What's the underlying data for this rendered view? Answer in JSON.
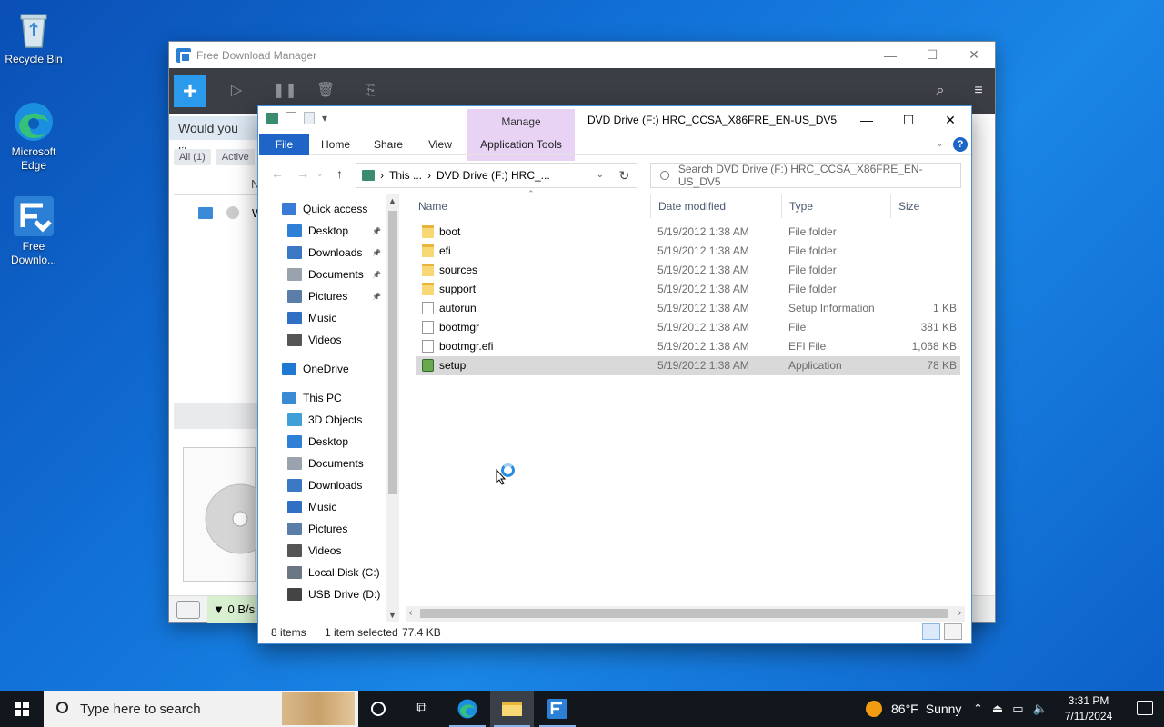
{
  "desktop": {
    "icons": [
      {
        "label": "Recycle Bin"
      },
      {
        "label": "Microsoft Edge"
      },
      {
        "label": "Free Downlo..."
      }
    ]
  },
  "fdm": {
    "title": "Free Download Manager",
    "prompt": "Would you like",
    "filters": [
      "All (1)",
      "Active"
    ],
    "list_header_initial": "N",
    "row_initial": "W",
    "speed": "▼ 0 B/s"
  },
  "explorer": {
    "manage_label": "Manage",
    "caption": "DVD Drive (F:) HRC_CCSA_X86FRE_EN-US_DV5",
    "ribbon_tabs": [
      "File",
      "Home",
      "Share",
      "View",
      "Application Tools"
    ],
    "address": {
      "crumb1": "This ...",
      "crumb2": "DVD Drive (F:) HRC_..."
    },
    "search": {
      "placeholder": "Search DVD Drive (F:) HRC_CCSA_X86FRE_EN-US_DV5"
    },
    "nav": [
      {
        "label": "Quick access",
        "icon": "star-icon",
        "color": "#3a7bd5",
        "pinned": false
      },
      {
        "label": "Desktop",
        "icon": "desktop-icon",
        "color": "#2f7fd6",
        "pinned": true
      },
      {
        "label": "Downloads",
        "icon": "download-icon",
        "color": "#3b78c4",
        "pinned": true
      },
      {
        "label": "Documents",
        "icon": "documents-icon",
        "color": "#9aa3ad",
        "pinned": true
      },
      {
        "label": "Pictures",
        "icon": "pictures-icon",
        "color": "#5a7ea8",
        "pinned": true
      },
      {
        "label": "Music",
        "icon": "music-icon",
        "color": "#2f6fc4",
        "pinned": false
      },
      {
        "label": "Videos",
        "icon": "videos-icon",
        "color": "#555",
        "pinned": false
      },
      {
        "label": "OneDrive",
        "icon": "cloud-icon",
        "color": "#1f78d1",
        "pinned": false
      },
      {
        "label": "This PC",
        "icon": "computer-icon",
        "color": "#3a8ad6",
        "pinned": false
      },
      {
        "label": "3D Objects",
        "icon": "cube-icon",
        "color": "#3fa0d8",
        "pinned": false
      },
      {
        "label": "Desktop",
        "icon": "desktop-icon",
        "color": "#2f7fd6",
        "pinned": false
      },
      {
        "label": "Documents",
        "icon": "documents-icon",
        "color": "#9aa3ad",
        "pinned": false
      },
      {
        "label": "Downloads",
        "icon": "download-icon",
        "color": "#3b78c4",
        "pinned": false
      },
      {
        "label": "Music",
        "icon": "music-icon",
        "color": "#2f6fc4",
        "pinned": false
      },
      {
        "label": "Pictures",
        "icon": "pictures-icon",
        "color": "#5a7ea8",
        "pinned": false
      },
      {
        "label": "Videos",
        "icon": "videos-icon",
        "color": "#555",
        "pinned": false
      },
      {
        "label": "Local Disk (C:)",
        "icon": "drive-icon",
        "color": "#6b7785",
        "pinned": false
      },
      {
        "label": "USB Drive (D:)",
        "icon": "usb-drive-icon",
        "color": "#444",
        "pinned": false
      }
    ],
    "columns": [
      "Name",
      "Date modified",
      "Type",
      "Size"
    ],
    "files": [
      {
        "name": "boot",
        "date": "5/19/2012 1:38 AM",
        "type": "File folder",
        "size": "",
        "kind": "folder"
      },
      {
        "name": "efi",
        "date": "5/19/2012 1:38 AM",
        "type": "File folder",
        "size": "",
        "kind": "folder"
      },
      {
        "name": "sources",
        "date": "5/19/2012 1:38 AM",
        "type": "File folder",
        "size": "",
        "kind": "folder"
      },
      {
        "name": "support",
        "date": "5/19/2012 1:38 AM",
        "type": "File folder",
        "size": "",
        "kind": "folder"
      },
      {
        "name": "autorun",
        "date": "5/19/2012 1:38 AM",
        "type": "Setup Information",
        "size": "1 KB",
        "kind": "file"
      },
      {
        "name": "bootmgr",
        "date": "5/19/2012 1:38 AM",
        "type": "File",
        "size": "381 KB",
        "kind": "file"
      },
      {
        "name": "bootmgr.efi",
        "date": "5/19/2012 1:38 AM",
        "type": "EFI File",
        "size": "1,068 KB",
        "kind": "file"
      },
      {
        "name": "setup",
        "date": "5/19/2012 1:38 AM",
        "type": "Application",
        "size": "78 KB",
        "kind": "app",
        "selected": true
      }
    ],
    "status": {
      "items": "8 items",
      "selected": "1 item selected",
      "size": "77.4 KB"
    }
  },
  "taskbar": {
    "search_placeholder": "Type here to search",
    "weather": {
      "temp": "86°F",
      "condition": "Sunny"
    },
    "time": "3:31 PM",
    "date": "7/11/2024"
  }
}
